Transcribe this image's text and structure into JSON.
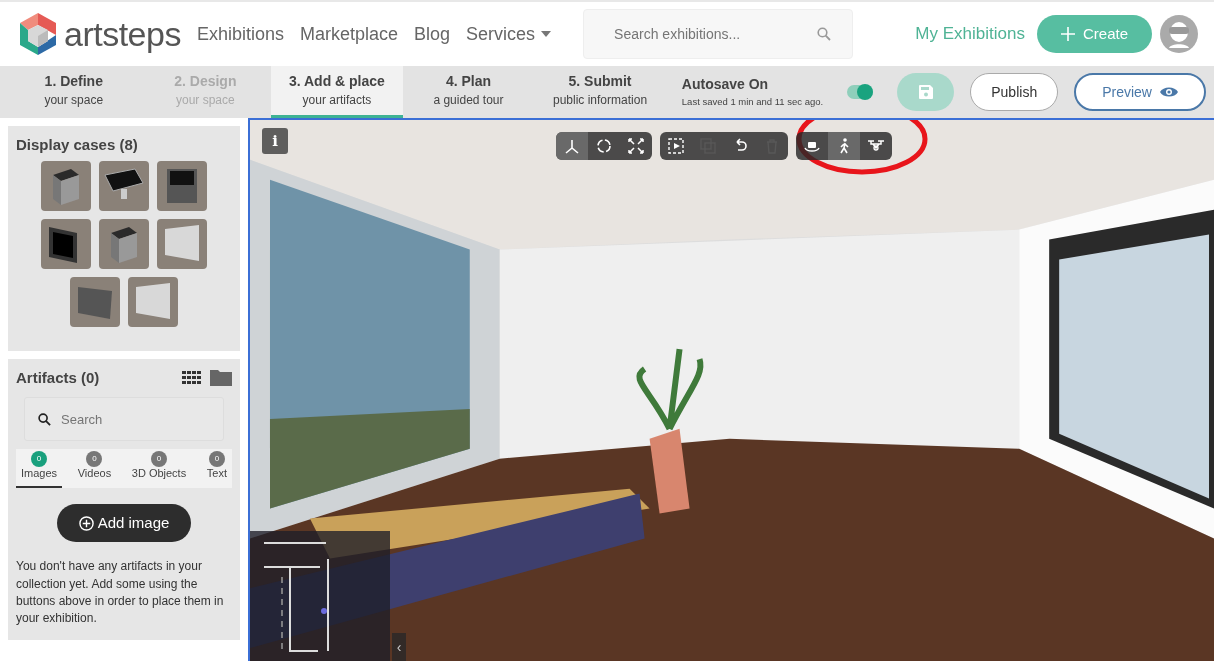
{
  "header": {
    "logo": "artsteps",
    "nav": [
      {
        "label": "Exhibitions",
        "kind": "link"
      },
      {
        "label": "Marketplace",
        "kind": "link"
      },
      {
        "label": "Blog",
        "kind": "link"
      },
      {
        "label": "Services",
        "kind": "dropdown"
      }
    ],
    "search": {
      "placeholder": "Search exhibitions..."
    },
    "my_exhibitions": "My Exhibitions",
    "create_button": "Create"
  },
  "steps": [
    {
      "title": "1. Define",
      "subtitle": "your space",
      "selected": false,
      "disabled": false
    },
    {
      "title": "2. Design",
      "subtitle": "your space",
      "selected": false,
      "disabled": true
    },
    {
      "title": "3. Add & place",
      "subtitle": "your artifacts",
      "selected": true,
      "disabled": false
    },
    {
      "title": "4. Plan",
      "subtitle": "a guided tour",
      "selected": false,
      "disabled": false
    },
    {
      "title": "5. Submit",
      "subtitle": "public information",
      "selected": false,
      "disabled": false
    }
  ],
  "autosave": {
    "label": "Autosave On",
    "note": "Last saved 1 min and 11 sec ago.",
    "on": true
  },
  "save_button": {
    "disabled": true
  },
  "publish_button": "Publish",
  "preview_button": "Preview",
  "display_cases": {
    "title": "Display cases (8)",
    "items": [
      {
        "kind": "pedestal"
      },
      {
        "kind": "table"
      },
      {
        "kind": "cabinet"
      },
      {
        "kind": "frame"
      },
      {
        "kind": "pedestal"
      },
      {
        "kind": "light-panel"
      },
      {
        "kind": "dark-panel"
      },
      {
        "kind": "light-panel"
      }
    ]
  },
  "artifacts": {
    "title": "Artifacts (0)",
    "search": {
      "placeholder": "Search"
    },
    "tabs": [
      {
        "label": "Images",
        "count": "0",
        "selected": true
      },
      {
        "label": "Videos",
        "count": "0",
        "selected": false
      },
      {
        "label": "3D Objects",
        "count": "0",
        "selected": false
      },
      {
        "label": "Text",
        "count": "0",
        "selected": false
      }
    ],
    "add_button": "Add image",
    "empty_note": "You don't have any artifacts in your collection yet. Add some using the buttons above in order to place them in your exhibition."
  },
  "viewer": {
    "info_button": "i",
    "collapse_button": "‹",
    "toolbar": [
      [
        {
          "kind": "move",
          "selected": true,
          "disabled": false
        },
        {
          "kind": "rotate",
          "selected": false,
          "disabled": false
        },
        {
          "kind": "scale",
          "selected": false,
          "disabled": false
        }
      ],
      [
        {
          "kind": "select",
          "selected": false,
          "disabled": false
        },
        {
          "kind": "duplicate",
          "selected": false,
          "disabled": true
        },
        {
          "kind": "undo",
          "selected": false,
          "disabled": false
        },
        {
          "kind": "delete",
          "selected": false,
          "disabled": true
        }
      ],
      [
        {
          "kind": "orbit",
          "selected": false,
          "disabled": false
        },
        {
          "kind": "walk",
          "selected": true,
          "disabled": false
        },
        {
          "kind": "drone",
          "selected": false,
          "disabled": false
        }
      ]
    ]
  }
}
